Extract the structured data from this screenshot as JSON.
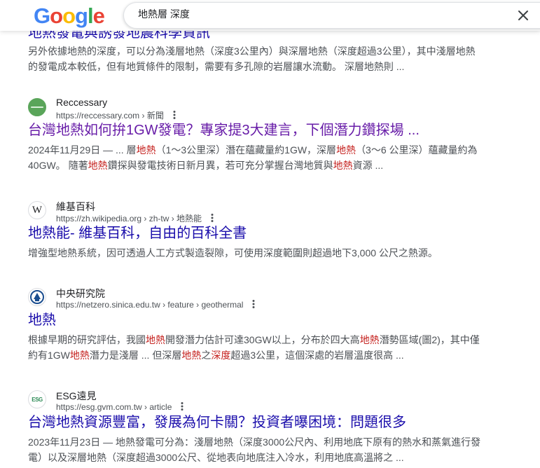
{
  "header": {
    "logo_letters": [
      "G",
      "o",
      "o",
      "g",
      "l",
      "e"
    ],
    "logo_colors": [
      "#4285F4",
      "#EA4335",
      "#FBBC05",
      "#4285F4",
      "#34A853",
      "#EA4335"
    ],
    "search_query": "地熱層 深度"
  },
  "top_result": {
    "title_clipped": "地熱發電與誘發地震科學資訊",
    "snippet_lines": [
      "另外依據地熱的深度，可以分為淺層地熱（深度3公里內）與深層地熱（深度超過3公里），其中淺層地熱",
      "的發電成本較低，但有地質條件的限制，需要有多孔隙的岩層讓水流動。 深層地熱則 ..."
    ]
  },
  "results": [
    {
      "site_name": "Reccessary",
      "url": "https://reccessary.com",
      "url_path": " › 新聞",
      "title": "台灣地熱如何拚1GW發電？專家提3大建言，下個潛力鑽探場 ...",
      "snippet": [
        [
          {
            "t": "2024年11月29日 — ... 層"
          },
          {
            "t": "地熱",
            "h": true
          },
          {
            "t": "（1～3公里深）潛在蘊藏量約1GW，深層"
          },
          {
            "t": "地熱",
            "h": true
          },
          {
            "t": "（3～6 公里深）蘊藏量約為"
          }
        ],
        [
          {
            "t": "40GW。 隨著"
          },
          {
            "t": "地熱",
            "h": true
          },
          {
            "t": "鑽探與發電技術日新月異，若可充分掌握台灣地質與"
          },
          {
            "t": "地熱",
            "h": true
          },
          {
            "t": "資源 ..."
          }
        ]
      ]
    },
    {
      "site_name": "維基百科",
      "url": "https://zh.wikipedia.org",
      "url_path": " › zh-tw › 地熱能",
      "title": "地熱能- 維基百科，自由的百科全書",
      "snippet": [
        [
          {
            "t": "增強型地熱系統，因可透過人工方式製造裂隙，可使用深度範圍則超過地下3,000 公尺之熱源。"
          }
        ]
      ]
    },
    {
      "site_name": "中央研究院",
      "url": "https://netzero.sinica.edu.tw",
      "url_path": " › feature › geothermal",
      "title": "地熱",
      "snippet": [
        [
          {
            "t": "根據早期的研究評估，我國"
          },
          {
            "t": "地熱",
            "h": true
          },
          {
            "t": "開發潛力估計可達30GW以上，分布於四大高"
          },
          {
            "t": "地熱",
            "h": true
          },
          {
            "t": "潛勢區域(圖2)，其中僅"
          }
        ],
        [
          {
            "t": "約有1GW"
          },
          {
            "t": "地熱",
            "h": true
          },
          {
            "t": "潛力是淺層 ... 但深層"
          },
          {
            "t": "地熱",
            "h": true
          },
          {
            "t": "之"
          },
          {
            "t": "深度",
            "h": true
          },
          {
            "t": "超過3公里，這個深處的岩層溫度很高 ..."
          }
        ]
      ]
    },
    {
      "site_name": "ESG遠見",
      "url": "https://esg.gvm.com.tw",
      "url_path": " › article",
      "title": "台灣地熱資源豐富，發展為何卡關？投資者曝困境：問題很多",
      "snippet": [
        [
          {
            "t": "2023年11月23日 — 地熱發電可分為：淺層地熱（深度3000公尺內、利用地底下原有的熱水和蒸氣進行發"
          }
        ],
        [
          {
            "t": "電）以及深層地熱（深度超過3000公尺、從地表向地底注入冷水，利用地底高溫將之 ..."
          }
        ]
      ]
    }
  ],
  "favicons": {
    "wikipedia_glyph": "W",
    "esg_glyph": "ESG"
  }
}
